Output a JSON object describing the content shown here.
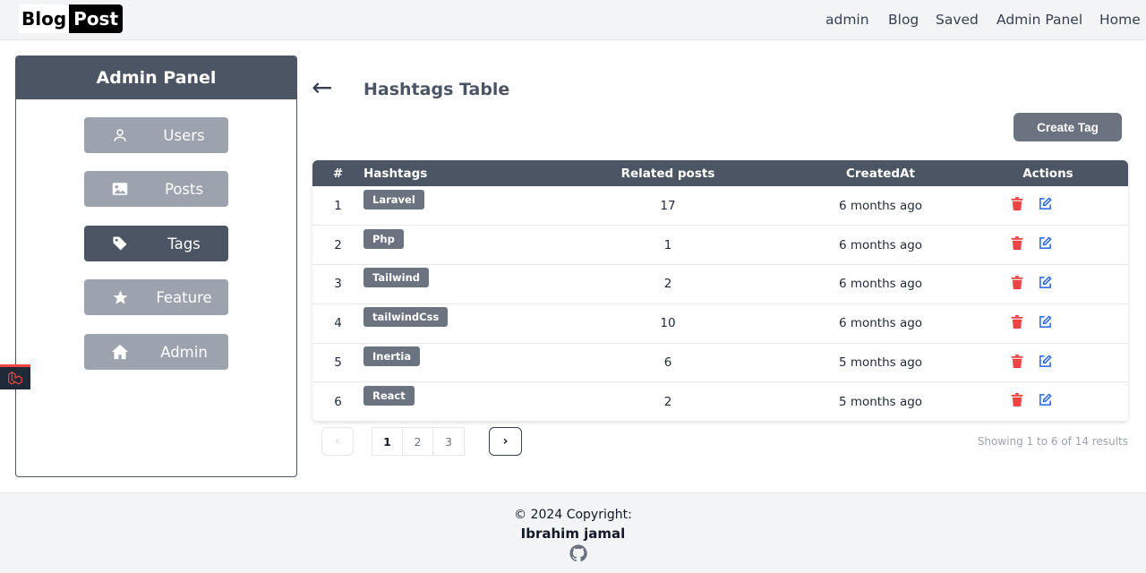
{
  "header": {
    "logo_part1": "Blog",
    "logo_part2": "Post",
    "nav": [
      "admin",
      "Blog",
      "Saved",
      "Admin Panel",
      "Home"
    ]
  },
  "sidebar": {
    "title": "Admin Panel",
    "items": [
      {
        "label": "Users",
        "icon": "user-icon",
        "active": false
      },
      {
        "label": "Posts",
        "icon": "image-icon",
        "active": false
      },
      {
        "label": "Tags",
        "icon": "tag-icon",
        "active": true
      },
      {
        "label": "Feature",
        "icon": "star-icon",
        "active": false
      },
      {
        "label": "Admin",
        "icon": "home-icon",
        "active": false
      }
    ]
  },
  "main": {
    "back_label": "←",
    "title": "Hashtags Table",
    "create_button": "Create Tag",
    "table": {
      "headers": [
        "#",
        "Hashtags",
        "Related posts",
        "CreatedAt",
        "Actions"
      ],
      "rows": [
        {
          "num": "1",
          "tag": "Laravel",
          "related": "17",
          "created": "6 months ago"
        },
        {
          "num": "2",
          "tag": "Php",
          "related": "1",
          "created": "6 months ago"
        },
        {
          "num": "3",
          "tag": "Tailwind",
          "related": "2",
          "created": "6 months ago"
        },
        {
          "num": "4",
          "tag": "tailwindCss",
          "related": "10",
          "created": "6 months ago"
        },
        {
          "num": "5",
          "tag": "Inertia",
          "related": "6",
          "created": "5 months ago"
        },
        {
          "num": "6",
          "tag": "React",
          "related": "2",
          "created": "5 months ago"
        }
      ]
    },
    "pagination": {
      "prev": "‹",
      "pages": [
        "1",
        "2",
        "3"
      ],
      "current": "1",
      "next": "›",
      "info": "Showing 1 to 6 of 14 results"
    }
  },
  "footer": {
    "copyright": "© 2024 Copyright:",
    "author": "Ibrahim jamal"
  },
  "colors": {
    "primary": "#4b5563",
    "muted": "#9ca3af",
    "delete": "#ef4444",
    "edit": "#2563eb"
  }
}
